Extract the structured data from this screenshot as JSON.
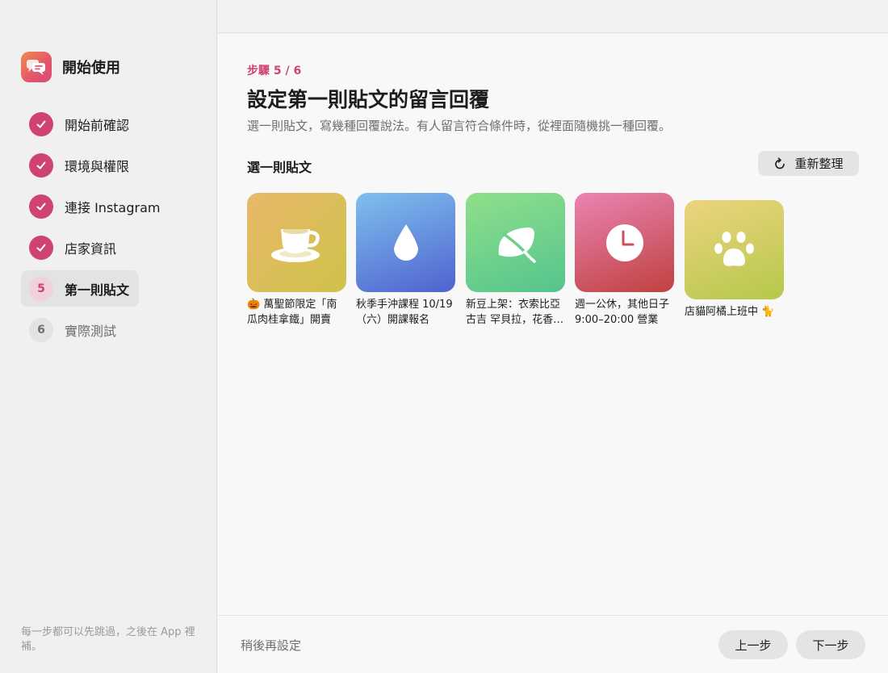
{
  "app": {
    "title": "開始使用",
    "icon": "chat-bubble-icon",
    "accent": "#cf4370"
  },
  "sidebar": {
    "steps": [
      {
        "number": "1",
        "label": "開始前確認",
        "state": "done"
      },
      {
        "number": "2",
        "label": "環境與權限",
        "state": "done"
      },
      {
        "number": "3",
        "label": "連接 Instagram",
        "state": "done"
      },
      {
        "number": "4",
        "label": "店家資訊",
        "state": "done"
      },
      {
        "number": "5",
        "label": "第一則貼文",
        "state": "current"
      },
      {
        "number": "6",
        "label": "實際測試",
        "state": "future"
      }
    ],
    "footer": "每一步都可以先跳過，之後在 App 裡補。"
  },
  "main": {
    "step_indicator": "步驟 5 / 6",
    "title": "設定第一則貼文的留言回覆",
    "subtitle": "選一則貼文，寫幾種回覆說法。有人留言符合條件時，從裡面隨機挑一種回覆。",
    "section_label": "選一則貼文",
    "refresh_label": "重新整理",
    "posts": [
      {
        "caption": "🎃 萬聖節限定「南瓜肉桂拿鐵」開賣",
        "icon": "coffee-cup-icon",
        "colors": [
          "#e8b86a",
          "#cfc24a"
        ]
      },
      {
        "caption": "秋季手沖課程 10/19（六）開課報名",
        "icon": "water-drop-icon",
        "colors": [
          "#7fc0ee",
          "#4f62cf"
        ]
      },
      {
        "caption": "新豆上架：衣索比亞 古吉 罕貝拉，花香明亮",
        "icon": "leaf-icon",
        "colors": [
          "#8fe08a",
          "#55c48e"
        ]
      },
      {
        "caption": "週一公休，其他日子 9:00–20:00 營業",
        "icon": "clock-icon",
        "colors": [
          "#ea84b3",
          "#c0413f"
        ]
      },
      {
        "caption": "店貓阿橘上班中 🐈",
        "icon": "paw-icon",
        "colors": [
          "#ecd47f",
          "#b6c84a"
        ]
      }
    ]
  },
  "footer": {
    "later_label": "稍後再設定",
    "prev_label": "上一步",
    "next_label": "下一步"
  }
}
